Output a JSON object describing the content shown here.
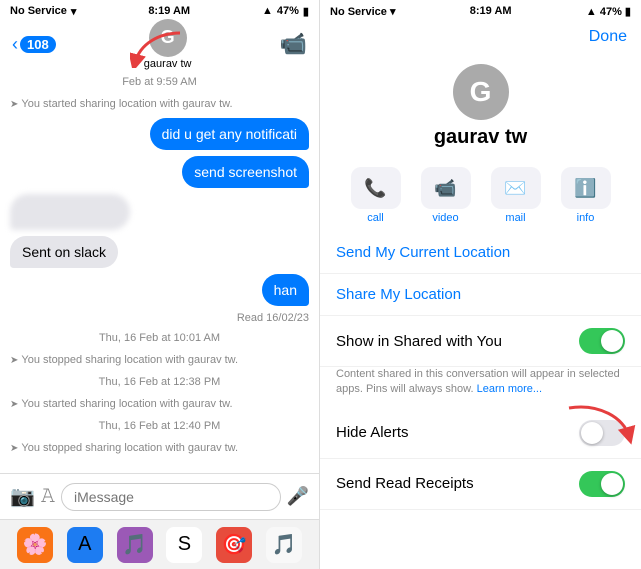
{
  "left": {
    "statusBar": {
      "carrier": "No Service",
      "time": "8:19 AM",
      "battery": "47%"
    },
    "nav": {
      "backCount": "108",
      "contactName": "gaurav tw",
      "contactInitial": "G"
    },
    "systemMessages": [
      {
        "id": "sm1",
        "text": "Feb at 9:59 AM"
      },
      {
        "id": "sm2",
        "text": "You started sharing location with gaurav tw."
      },
      {
        "id": "sm3",
        "text": "Thu, 16 Feb at 10:01 AM"
      },
      {
        "id": "sm4",
        "text": "You stopped sharing location with gaurav tw."
      },
      {
        "id": "sm5",
        "text": "Thu, 16 Feb at 12:38 PM"
      },
      {
        "id": "sm6",
        "text": "You started sharing location with gaurav tw."
      },
      {
        "id": "sm7",
        "text": "Thu, 16 Feb at 12:40 PM"
      },
      {
        "id": "sm8",
        "text": "You stopped sharing location with gaurav tw."
      }
    ],
    "bubbles": [
      {
        "id": "b1",
        "side": "right",
        "text": "did u get any notificati"
      },
      {
        "id": "b2",
        "side": "right",
        "text": "send screenshot"
      },
      {
        "id": "b3",
        "side": "left-blurred",
        "text": ""
      },
      {
        "id": "b4",
        "side": "left",
        "text": "Sent on slack"
      },
      {
        "id": "b5",
        "side": "right",
        "text": "han"
      }
    ],
    "readLabel": "Read 16/02/23",
    "inputPlaceholder": "iMessage"
  },
  "right": {
    "statusBar": {
      "carrier": "No Service",
      "time": "8:19 AM",
      "battery": "47%"
    },
    "doneLabel": "Done",
    "contactName": "gaurav tw",
    "contactInitial": "G",
    "actions": [
      {
        "id": "a1",
        "icon": "📞",
        "label": "call"
      },
      {
        "id": "a2",
        "icon": "📹",
        "label": "video"
      },
      {
        "id": "a3",
        "icon": "✉️",
        "label": "mail"
      },
      {
        "id": "a4",
        "icon": "ℹ️",
        "label": "info"
      }
    ],
    "menuItems": [
      {
        "id": "m1",
        "label": "Send My Current Location",
        "type": "link",
        "toggle": null
      },
      {
        "id": "m2",
        "label": "Share My Location",
        "type": "link",
        "toggle": null
      },
      {
        "id": "m3",
        "label": "Show in Shared with You",
        "type": "toggle",
        "toggleOn": true
      },
      {
        "id": "m4",
        "label": "Hide Alerts",
        "type": "toggle",
        "toggleOn": false
      },
      {
        "id": "m5",
        "label": "Send Read Receipts",
        "type": "toggle",
        "toggleOn": true
      }
    ],
    "subLabel": "Content shared in this conversation will appear in selected apps. Pins will always show.",
    "learnMore": "Learn more...",
    "hasArrowOnHideAlerts": true
  }
}
